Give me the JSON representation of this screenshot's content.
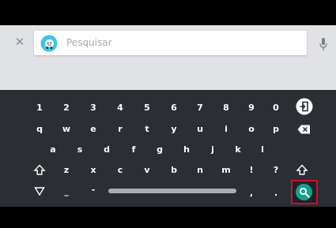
{
  "search": {
    "placeholder": "Pesquisar",
    "close_icon": "close-icon",
    "app_icon": "waze-icon",
    "mic_icon": "microphone-icon"
  },
  "keyboard": {
    "row1": [
      "1",
      "2",
      "3",
      "4",
      "5",
      "6",
      "7",
      "8",
      "9",
      "0"
    ],
    "row2": [
      "q",
      "w",
      "e",
      "r",
      "t",
      "y",
      "u",
      "i",
      "o",
      "p"
    ],
    "row3": [
      "a",
      "s",
      "d",
      "f",
      "g",
      "h",
      "j",
      "k",
      "l"
    ],
    "row4": [
      "z",
      "x",
      "c",
      "v",
      "b",
      "n",
      "m",
      "!",
      "?"
    ],
    "row5_symbols": [
      "_",
      "-",
      ",",
      "."
    ],
    "enter_icon": "enter-icon",
    "backspace_icon": "backspace-icon",
    "shift_icon": "shift-icon",
    "hide_keyboard_icon": "hide-keyboard-icon",
    "search_icon": "search-icon"
  },
  "colors": {
    "header_bg": "#e1e2e6",
    "keyboard_bg": "#2b2e33",
    "search_button": "#14a08f",
    "highlight": "#c8102e"
  }
}
